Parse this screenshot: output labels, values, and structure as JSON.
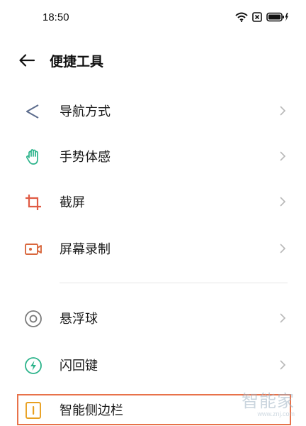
{
  "status_bar": {
    "time": "18:50"
  },
  "header": {
    "title": "便捷工具"
  },
  "items": [
    {
      "label": "导航方式",
      "icon": "navigation-triangle-icon"
    },
    {
      "label": "手势体感",
      "icon": "hand-gesture-icon"
    },
    {
      "label": "截屏",
      "icon": "screenshot-crop-icon"
    },
    {
      "label": "屏幕录制",
      "icon": "screen-record-icon"
    },
    {
      "label": "悬浮球",
      "icon": "floating-ball-icon"
    },
    {
      "label": "闪回键",
      "icon": "flash-back-icon"
    },
    {
      "label": "智能侧边栏",
      "icon": "smart-sidebar-icon"
    }
  ],
  "watermark": {
    "main": "智能家",
    "sub": "www.znj.com"
  },
  "colors": {
    "navigation_icon": "#5b6b8c",
    "gesture_icon": "#2bb38a",
    "screenshot_icon": "#e05a43",
    "record_icon": "#d9683e",
    "floating_icon": "#7a7a7a",
    "flashback_icon": "#2bb38a",
    "sidebar_icon": "#e8a020",
    "highlight_border": "#e8724a"
  }
}
